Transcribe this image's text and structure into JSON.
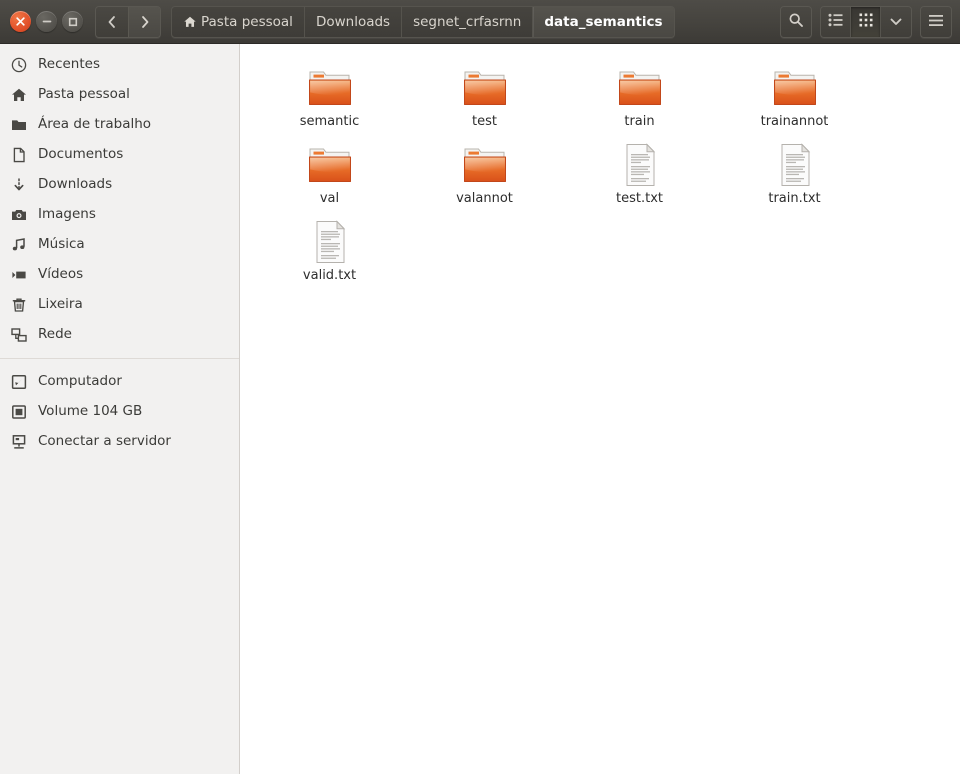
{
  "window": {
    "controls": [
      {
        "name": "close",
        "glyph": "×"
      },
      {
        "name": "minimize",
        "glyph": "−"
      },
      {
        "name": "maximize",
        "glyph": "□"
      }
    ]
  },
  "toolbar": {
    "back_label": "‹",
    "forward_label": "›",
    "search_icon": "search-icon",
    "list_view_icon": "list-view-icon",
    "grid_view_icon": "grid-view-icon",
    "view_options_icon": "chevron-down-icon",
    "menu_icon": "hamburger-menu-icon"
  },
  "breadcrumbs": [
    {
      "label": "Pasta pessoal",
      "icon": "home-icon",
      "active": false
    },
    {
      "label": "Downloads",
      "icon": "",
      "active": false
    },
    {
      "label": "segnet_crfasrnn",
      "icon": "",
      "active": false
    },
    {
      "label": "data_semantics",
      "icon": "",
      "active": true
    }
  ],
  "sidebar": {
    "groups": [
      {
        "items": [
          {
            "label": "Recentes",
            "icon": "clock-icon"
          },
          {
            "label": "Pasta pessoal",
            "icon": "home-icon"
          },
          {
            "label": "Área de trabalho",
            "icon": "folder-icon"
          },
          {
            "label": "Documentos",
            "icon": "document-icon"
          },
          {
            "label": "Downloads",
            "icon": "download-icon"
          },
          {
            "label": "Imagens",
            "icon": "camera-icon"
          },
          {
            "label": "Música",
            "icon": "music-note-icon"
          },
          {
            "label": "Vídeos",
            "icon": "video-icon"
          },
          {
            "label": "Lixeira",
            "icon": "trash-icon"
          },
          {
            "label": "Rede",
            "icon": "network-icon"
          }
        ]
      },
      {
        "items": [
          {
            "label": "Computador",
            "icon": "computer-icon"
          },
          {
            "label": "Volume 104 GB",
            "icon": "drive-icon"
          },
          {
            "label": "Conectar a servidor",
            "icon": "server-connect-icon"
          }
        ]
      }
    ]
  },
  "files": [
    {
      "name": "semantic",
      "type": "folder"
    },
    {
      "name": "test",
      "type": "folder"
    },
    {
      "name": "train",
      "type": "folder"
    },
    {
      "name": "trainannot",
      "type": "folder"
    },
    {
      "name": "val",
      "type": "folder"
    },
    {
      "name": "valannot",
      "type": "folder"
    },
    {
      "name": "test.txt",
      "type": "text"
    },
    {
      "name": "train.txt",
      "type": "text"
    },
    {
      "name": "valid.txt",
      "type": "text"
    }
  ],
  "colors": {
    "titlebar": "#45433e",
    "sidebar_bg": "#f2f1f0",
    "content_bg": "#ffffff",
    "folder_orange": "#e8621f",
    "close_button": "#e2512a",
    "label_text": "#2d2d2d"
  }
}
